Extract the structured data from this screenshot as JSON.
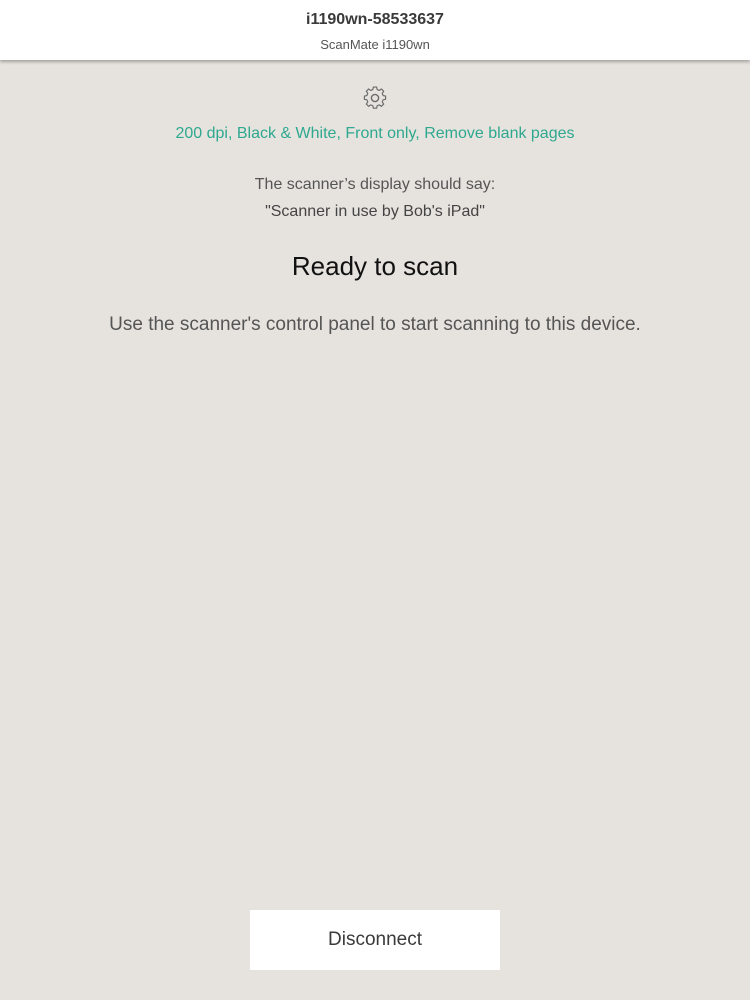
{
  "header": {
    "device_name": "i1190wn-58533637",
    "device_model": "ScanMate i1190wn"
  },
  "settings": {
    "icon": "gear-icon",
    "summary": "200 dpi, Black & White, Front only, Remove blank pages"
  },
  "scanner_display": {
    "note": "The scanner’s display should say:",
    "message": "\"Scanner in use by Bob's iPad\""
  },
  "status": {
    "title": "Ready to scan",
    "instruction": "Use the scanner's control panel to start scanning to this device."
  },
  "footer": {
    "disconnect_label": "Disconnect"
  },
  "colors": {
    "background": "#e6e3de",
    "accent": "#2ea88f",
    "header_background": "#ffffff"
  }
}
